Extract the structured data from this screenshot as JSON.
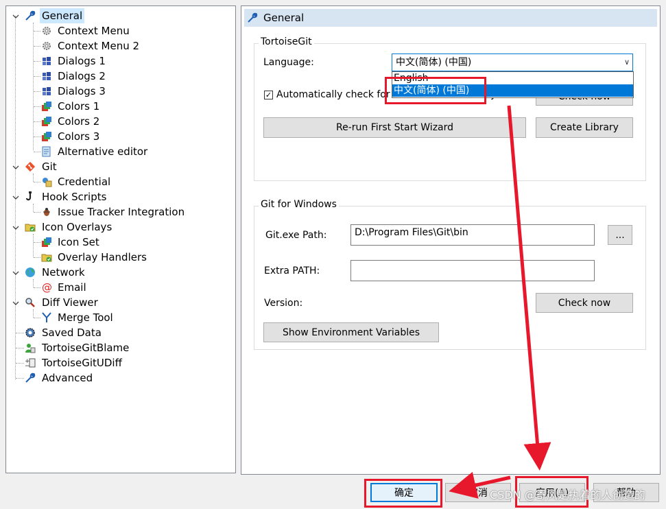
{
  "tree": {
    "items": [
      {
        "label": "General",
        "icon": "wrench-icon"
      },
      {
        "label": "Context Menu",
        "icon": "gear-icon"
      },
      {
        "label": "Context Menu 2",
        "icon": "gear-icon"
      },
      {
        "label": "Dialogs 1",
        "icon": "windows-icon"
      },
      {
        "label": "Dialogs 2",
        "icon": "windows-icon"
      },
      {
        "label": "Dialogs 3",
        "icon": "windows-icon"
      },
      {
        "label": "Colors 1",
        "icon": "colors-icon"
      },
      {
        "label": "Colors 2",
        "icon": "colors-icon"
      },
      {
        "label": "Colors 3",
        "icon": "colors-icon"
      },
      {
        "label": "Alternative editor",
        "icon": "editor-icon"
      },
      {
        "label": "Git",
        "icon": "git-icon"
      },
      {
        "label": "Credential",
        "icon": "credential-icon"
      },
      {
        "label": "Hook Scripts",
        "icon": "hook-icon"
      },
      {
        "label": "Issue Tracker Integration",
        "icon": "bug-icon"
      },
      {
        "label": "Icon Overlays",
        "icon": "overlay-folder-icon"
      },
      {
        "label": "Icon Set",
        "icon": "colors-icon"
      },
      {
        "label": "Overlay Handlers",
        "icon": "overlay-folder-icon"
      },
      {
        "label": "Network",
        "icon": "globe-icon"
      },
      {
        "label": "Email",
        "icon": "at-icon"
      },
      {
        "label": "Diff Viewer",
        "icon": "magnifier-icon"
      },
      {
        "label": "Merge Tool",
        "icon": "merge-icon"
      },
      {
        "label": "Saved Data",
        "icon": "saved-data-icon"
      },
      {
        "label": "TortoiseGitBlame",
        "icon": "blame-icon"
      },
      {
        "label": "TortoiseGitUDiff",
        "icon": "udiff-icon"
      },
      {
        "label": "Advanced",
        "icon": "wrench-icon"
      }
    ]
  },
  "panel": {
    "title": "General",
    "tortoisegit_group": "TortoiseGit",
    "language_label": "Language:",
    "language_value": "中文(简体) (中国)",
    "language_options": [
      "English",
      "中文(简体) (中国)"
    ],
    "auto_check_label": "Automatically check for newer versions every week",
    "auto_check_checked": true,
    "check_now_label": "Check now",
    "rerun_wizard_label": "Re-run First Start Wizard",
    "create_library_label": "Create Library",
    "gfw_group": "Git for Windows",
    "git_path_label": "Git.exe Path:",
    "git_path_value": "D:\\Program Files\\Git\\bin",
    "browse_label": "...",
    "extra_path_label": "Extra PATH:",
    "extra_path_value": "",
    "version_label": "Version:",
    "check_now2_label": "Check now",
    "show_env_label": "Show Environment Variables"
  },
  "footer": {
    "ok_label": "确定",
    "cancel_label": "取消",
    "apply_label": "应用(A)",
    "help_label": "帮助"
  },
  "watermark": "CSDN @寄风是执着的人创造的",
  "colors": {
    "annotation_red": "#e8182c",
    "selection_blue": "#0078d7",
    "tree_selected": "#cce8ff"
  }
}
